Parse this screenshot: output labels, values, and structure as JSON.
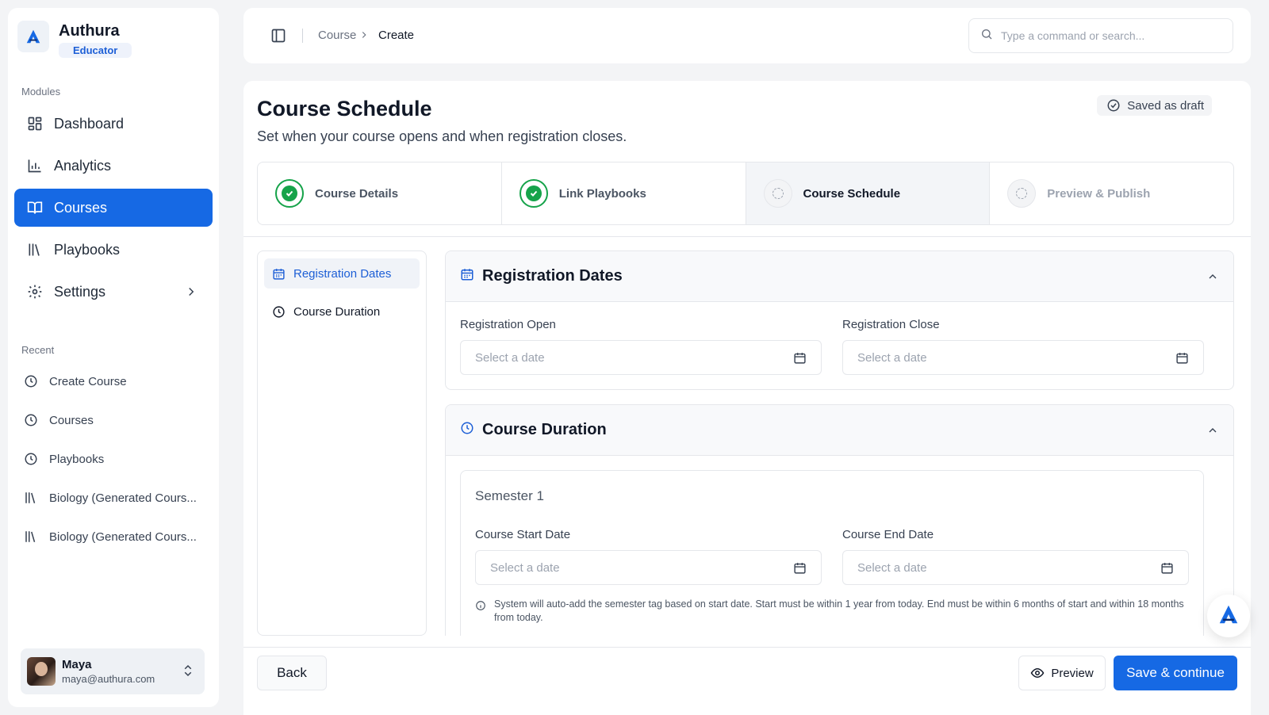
{
  "brand": {
    "name": "Authura",
    "role": "Educator"
  },
  "sidebar": {
    "modules_label": "Modules",
    "nav": [
      {
        "label": "Dashboard",
        "icon": "dashboard-icon"
      },
      {
        "label": "Analytics",
        "icon": "bar-chart-icon"
      },
      {
        "label": "Courses",
        "icon": "book-open-icon",
        "active": true
      },
      {
        "label": "Playbooks",
        "icon": "library-icon"
      },
      {
        "label": "Settings",
        "icon": "gear-icon"
      }
    ],
    "recent_label": "Recent",
    "recent": [
      {
        "label": "Create Course",
        "icon": "clock-icon"
      },
      {
        "label": "Courses",
        "icon": "clock-icon"
      },
      {
        "label": "Playbooks",
        "icon": "clock-icon"
      },
      {
        "label": "Biology (Generated Cours...",
        "icon": "library-icon"
      },
      {
        "label": "Biology (Generated Cours...",
        "icon": "library-icon"
      }
    ],
    "user": {
      "name": "Maya",
      "email": "maya@authura.com"
    }
  },
  "topbar": {
    "breadcrumb": [
      "Course",
      "Create"
    ],
    "search_placeholder": "Type a command or search..."
  },
  "page": {
    "title": "Course Schedule",
    "subtitle": "Set when your course opens and when registration closes.",
    "status": "Saved as draft"
  },
  "steps": [
    {
      "label": "Course Details",
      "state": "done"
    },
    {
      "label": "Link Playbooks",
      "state": "done"
    },
    {
      "label": "Course Schedule",
      "state": "current"
    },
    {
      "label": "Preview & Publish",
      "state": "pending"
    }
  ],
  "subnav": [
    {
      "label": "Registration Dates",
      "active": true
    },
    {
      "label": "Course Duration",
      "active": false
    }
  ],
  "registration": {
    "title": "Registration Dates",
    "open_label": "Registration Open",
    "open_placeholder": "Select a date",
    "close_label": "Registration Close",
    "close_placeholder": "Select a date"
  },
  "duration": {
    "title": "Course Duration",
    "semester_title": "Semester 1",
    "start_label": "Course Start Date",
    "start_placeholder": "Select a date",
    "end_label": "Course End Date",
    "end_placeholder": "Select a date",
    "hint": "System will auto-add the semester tag based on start date. Start must be within 1 year from today. End must be within 6 months of start and within 18 months from today."
  },
  "actions": {
    "back": "Back",
    "preview": "Preview",
    "save": "Save & continue"
  },
  "colors": {
    "primary": "#1669e4",
    "success": "#16a34a"
  }
}
